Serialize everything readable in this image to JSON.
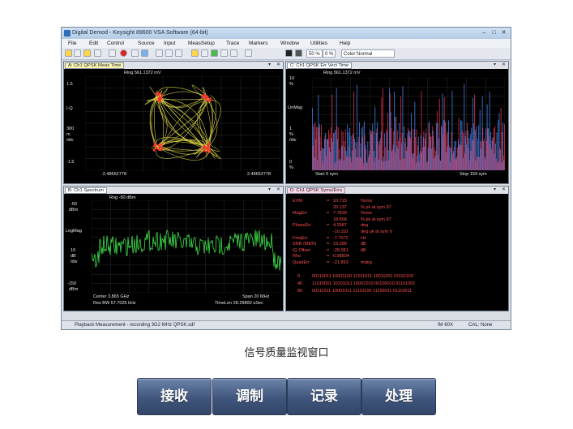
{
  "window": {
    "title": "Digital Demod - Keysight 89600 VSA Software (64-bit)",
    "menu": [
      "File",
      "Edit",
      "Control",
      "Source",
      "Input",
      "MeasSetup",
      "Trace",
      "Markers",
      "Window",
      "Utilities",
      "Help"
    ],
    "toolbar": {
      "zoom": "50 %",
      "percent": "0 %",
      "color_mode": "Color Normal"
    }
  },
  "panels": {
    "a": {
      "tab": "A: Ch1 QPSK Meas Time",
      "header": "Ring 561.1372 mV",
      "y_top": "1.5",
      "y_label": "I-Q",
      "y_div": "300",
      "y_div_unit": "m",
      "y_div_label": "/div",
      "y_bottom": "-1.5",
      "x_left": "-2.48652778",
      "x_right": "2.48652778"
    },
    "c": {
      "tab": "C: Ch1 QPSK Err Vect Time",
      "header": "Ring 561.1372 mV",
      "y_top": "10",
      "y_top_unit": "%",
      "y_label": "LinMag",
      "y_div": "1",
      "y_div_unit": "%",
      "y_div_label": "/div",
      "y_bottom": "0",
      "y_bottom_unit": "%",
      "x_left": "Start 0  sym",
      "x_right": "Stop 159  sym"
    },
    "b": {
      "tab": "B: Ch1 Spectrum",
      "header": "Rng -50 dBm",
      "y_top": "-50",
      "y_top_unit": "dBm",
      "y_label": "LogMag",
      "y_div": "10",
      "y_div_unit": "dB",
      "y_div_label": "/div",
      "y_bottom": "-150",
      "y_bottom_unit": "dBm",
      "center": "Center 3.865 GHz",
      "span": "Span 20 MHz",
      "rbw": "Res BW 57.7025 kHz",
      "time_len": "TimeLen 28.29800 uSec"
    },
    "d": {
      "tab": "D: Ch1 QPSK Syms/Errs",
      "rows": [
        {
          "name": "EVM",
          "eq": "=",
          "value": "10.715",
          "unit": "%rms"
        },
        {
          "name": "",
          "eq": "",
          "value": "20.137",
          "unit": "% pk  at  sym    97"
        },
        {
          "name": "MagErr",
          "eq": "=",
          "value": "7.7839",
          "unit": "%rms"
        },
        {
          "name": "",
          "eq": "",
          "value": "18.868",
          "unit": "% pk  at  sym    97"
        },
        {
          "name": "PhaseErr",
          "eq": "=",
          "value": "4.2987",
          "unit": "deg"
        },
        {
          "name": "",
          "eq": "",
          "value": "-10.110",
          "unit": "deg pk  at  sym    9"
        },
        {
          "name": "FreqErr",
          "eq": "=",
          "value": "-7.7072",
          "unit": "Hz"
        },
        {
          "name": "SNR (MER)",
          "eq": "=",
          "value": "19.399",
          "unit": "dB"
        },
        {
          "name": "IQ Offset",
          "eq": "=",
          "value": "-28.081",
          "unit": "dB"
        },
        {
          "name": "Rho",
          "eq": "=",
          "value": "0.98834",
          "unit": ""
        },
        {
          "name": "QuadErr",
          "eq": "=",
          "value": "-21.893",
          "unit": "mdeg"
        }
      ],
      "symbols": [
        {
          "idx": "0",
          "bits": "00110011  10001100  11011011  10011001  01110100"
        },
        {
          "idx": "40",
          "bits": "11010001  10101011  10001010  00100010  01101001"
        },
        {
          "idx": "80",
          "bits": "00111011  10001011  11110100  11100011  01110011"
        }
      ]
    }
  },
  "status": {
    "left": "Playback Measurement - recording 3G2 MHz QPSK.sdf",
    "mid": "IM 60X",
    "right": "CAL: None"
  },
  "caption": "信号质量监视窗口",
  "buttons": [
    "接收",
    "调制",
    "记录",
    "处理"
  ],
  "colors": {
    "trace_yellow": "#e8e04a",
    "trace_blue": "#3f7fe0",
    "trace_red": "#d2304a",
    "trace_green": "#3ee04a",
    "marker_red": "#ff3030",
    "button_blue": "#3f557c"
  }
}
